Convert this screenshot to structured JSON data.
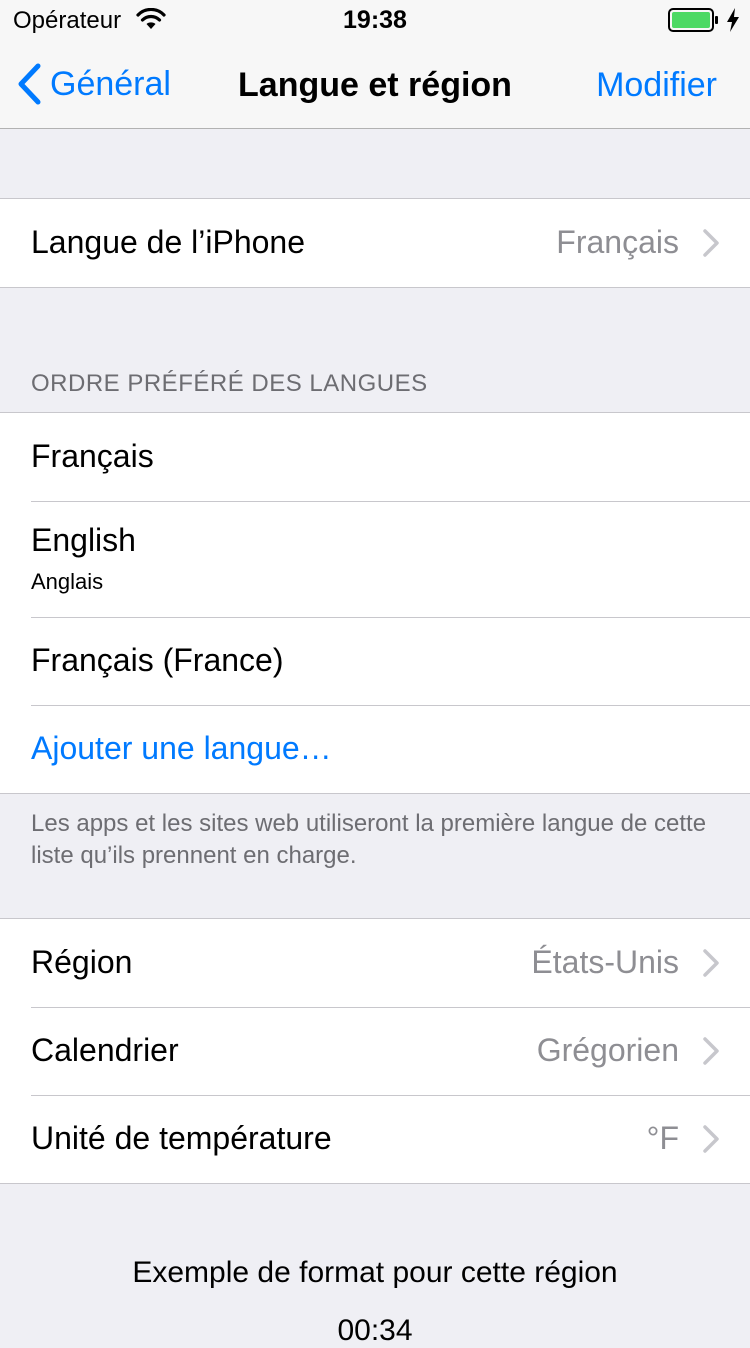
{
  "status_bar": {
    "carrier": "Opérateur",
    "time": "19:38"
  },
  "nav": {
    "back_label": "Général",
    "title": "Langue et région",
    "edit_label": "Modifier"
  },
  "iphone_language": {
    "label": "Langue de l’iPhone",
    "value": "Français"
  },
  "preferred_languages": {
    "header": "ORDRE PRÉFÉRÉ DES LANGUES",
    "items": [
      {
        "label": "Français",
        "subtitle": ""
      },
      {
        "label": "English",
        "subtitle": "Anglais"
      },
      {
        "label": "Français (France)",
        "subtitle": ""
      }
    ],
    "add_label": "Ajouter une langue…",
    "footer": "Les apps et les sites web utiliseront la première langue de cette liste qu’ils prennent en charge."
  },
  "region_settings": {
    "items": [
      {
        "label": "Région",
        "value": "États-Unis"
      },
      {
        "label": "Calendrier",
        "value": "Grégorien"
      },
      {
        "label": "Unité de température",
        "value": "°F"
      }
    ]
  },
  "format_example": {
    "title": "Exemple de format pour cette région",
    "time": "00:34"
  },
  "colors": {
    "accent": "#007aff",
    "background": "#efeff4",
    "secondary_text": "#8e8e93",
    "battery": "#4cd964"
  }
}
